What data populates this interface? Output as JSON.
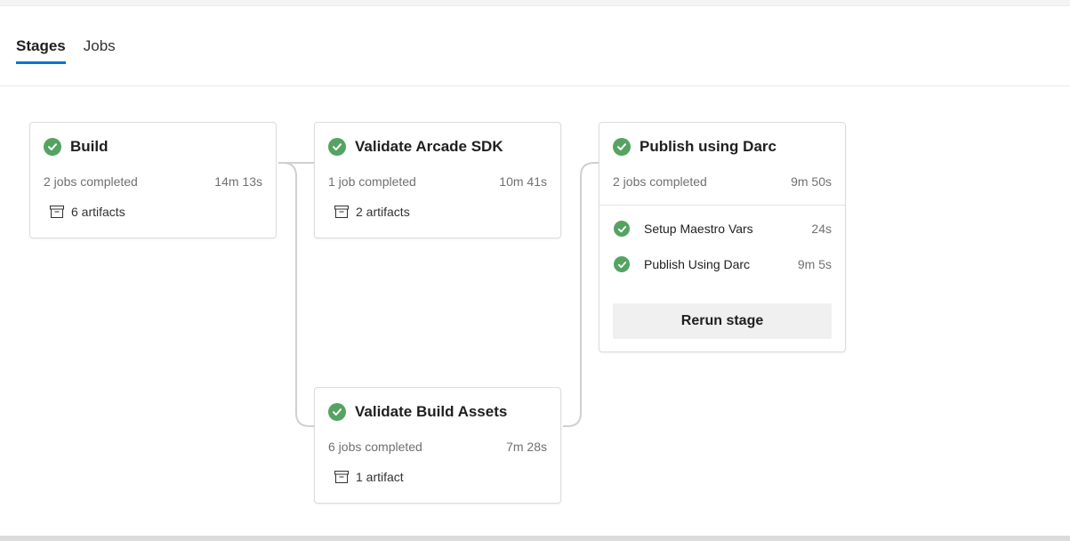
{
  "tabs": [
    {
      "label": "Stages",
      "active": true
    },
    {
      "label": "Jobs",
      "active": false
    }
  ],
  "colors": {
    "accent": "#0078d4",
    "success": "#55a362"
  },
  "stages": {
    "build": {
      "name": "Build",
      "status": "succeeded",
      "jobs_completed": "2 jobs completed",
      "duration": "14m 13s",
      "artifacts": "6 artifacts"
    },
    "validate_arcade": {
      "name": "Validate Arcade SDK",
      "status": "succeeded",
      "jobs_completed": "1 job completed",
      "duration": "10m 41s",
      "artifacts": "2 artifacts"
    },
    "validate_assets": {
      "name": "Validate Build Assets",
      "status": "succeeded",
      "jobs_completed": "6 jobs completed",
      "duration": "7m 28s",
      "artifacts": "1 artifact"
    },
    "publish": {
      "name": "Publish using Darc",
      "status": "succeeded",
      "jobs_completed": "2 jobs completed",
      "duration": "9m 50s",
      "jobs": [
        {
          "name": "Setup Maestro Vars",
          "duration": "24s",
          "status": "succeeded"
        },
        {
          "name": "Publish Using Darc",
          "duration": "9m 5s",
          "status": "succeeded"
        }
      ],
      "rerun_label": "Rerun stage"
    }
  },
  "icons": {
    "status": "check-circle-icon",
    "artifact": "artifact-box-icon"
  }
}
